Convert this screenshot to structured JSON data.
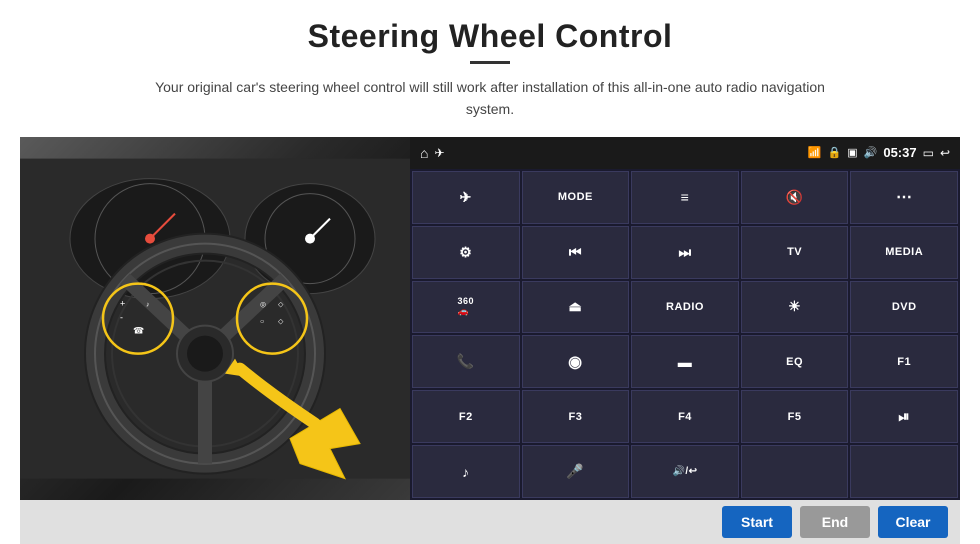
{
  "page": {
    "title": "Steering Wheel Control",
    "subtitle": "Your original car's steering wheel control will still work after installation of this all-in-one auto radio navigation system.",
    "divider": true
  },
  "topbar": {
    "time": "05:37",
    "home_icon": "⌂",
    "wifi_icon": "📶",
    "lock_icon": "🔒",
    "sd_icon": "💾",
    "bt_icon": "🔊",
    "recent_icon": "▭",
    "back_icon": "↩"
  },
  "buttons": [
    {
      "icon": "✈",
      "label": "",
      "row": 1,
      "col": 1
    },
    {
      "icon": "",
      "label": "MODE",
      "row": 1,
      "col": 2
    },
    {
      "icon": "≡",
      "label": "",
      "row": 1,
      "col": 3
    },
    {
      "icon": "🔇",
      "label": "",
      "row": 1,
      "col": 4
    },
    {
      "icon": "⋯",
      "label": "",
      "row": 1,
      "col": 5
    },
    {
      "icon": "⊙",
      "label": "",
      "row": 2,
      "col": 1
    },
    {
      "icon": "⏮",
      "label": "",
      "row": 2,
      "col": 2
    },
    {
      "icon": "⏭",
      "label": "",
      "row": 2,
      "col": 3
    },
    {
      "icon": "",
      "label": "TV",
      "row": 2,
      "col": 4
    },
    {
      "icon": "",
      "label": "MEDIA",
      "row": 2,
      "col": 5
    },
    {
      "icon": "360",
      "label": "",
      "row": 3,
      "col": 1
    },
    {
      "icon": "▲",
      "label": "",
      "row": 3,
      "col": 2
    },
    {
      "icon": "",
      "label": "RADIO",
      "row": 3,
      "col": 3
    },
    {
      "icon": "☀",
      "label": "",
      "row": 3,
      "col": 4
    },
    {
      "icon": "",
      "label": "DVD",
      "row": 3,
      "col": 5
    },
    {
      "icon": "📞",
      "label": "",
      "row": 4,
      "col": 1
    },
    {
      "icon": "◉",
      "label": "",
      "row": 4,
      "col": 2
    },
    {
      "icon": "▬",
      "label": "",
      "row": 4,
      "col": 3
    },
    {
      "icon": "",
      "label": "EQ",
      "row": 4,
      "col": 4
    },
    {
      "icon": "",
      "label": "F1",
      "row": 4,
      "col": 5
    },
    {
      "icon": "",
      "label": "F2",
      "row": 5,
      "col": 1
    },
    {
      "icon": "",
      "label": "F3",
      "row": 5,
      "col": 2
    },
    {
      "icon": "",
      "label": "F4",
      "row": 5,
      "col": 3
    },
    {
      "icon": "",
      "label": "F5",
      "row": 5,
      "col": 4
    },
    {
      "icon": "⏯",
      "label": "",
      "row": 5,
      "col": 5
    },
    {
      "icon": "♪",
      "label": "",
      "row": 6,
      "col": 1
    },
    {
      "icon": "🎤",
      "label": "",
      "row": 6,
      "col": 2
    },
    {
      "icon": "🔊/↩",
      "label": "",
      "row": 6,
      "col": 3
    },
    {
      "icon": "",
      "label": "",
      "row": 6,
      "col": 4
    },
    {
      "icon": "",
      "label": "",
      "row": 6,
      "col": 5
    }
  ],
  "bottom_buttons": {
    "start_label": "Start",
    "end_label": "End",
    "clear_label": "Clear"
  }
}
